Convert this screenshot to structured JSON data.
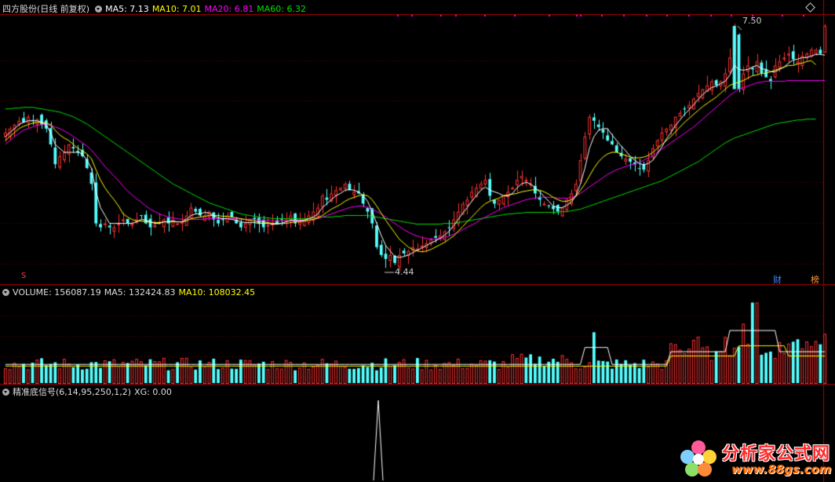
{
  "main_panel": {
    "stock_name": "四方股份",
    "period_label": "(日线 前复权)",
    "ma5": {
      "label": "MA5: 7.13",
      "color": "#ffffff"
    },
    "ma10": {
      "label": "MA10: 7.01",
      "color": "#ffff00"
    },
    "ma20": {
      "label": "MA20: 6.81",
      "color": "#ff00ff"
    },
    "ma60": {
      "label": "MA60: 6.32",
      "color": "#00e000"
    },
    "high_marker": "7.50",
    "low_marker": "4.44",
    "badge_fin": "财",
    "badge_rank": "榜",
    "badge_s": "S"
  },
  "volume_panel": {
    "volume_label": "VOLUME: 156087.19",
    "ma5_label": "MA5: 132424.83",
    "ma10_label": "MA10: 108032.45"
  },
  "indicator_panel": {
    "name_label": "精准底信号",
    "params": "(6,14,95,250,1,2)",
    "xg_label": "XG: 0.00"
  },
  "watermark": {
    "site": "分析家公式网",
    "url": "www.88gs.com"
  },
  "colors": {
    "up": "#ff3232",
    "down": "#54ffff",
    "ma5": "#ffffff",
    "ma10": "#ffff00",
    "ma20": "#ff00ff",
    "ma60": "#00e000",
    "grid": "#8b0000"
  },
  "chart_data": {
    "type": "candlestick",
    "price_range": [
      4.3,
      7.65
    ],
    "closes": [
      6.15,
      6.2,
      6.25,
      6.3,
      6.28,
      6.35,
      6.3,
      6.32,
      6.25,
      6.2,
      6.0,
      5.75,
      5.85,
      5.9,
      6.0,
      5.95,
      5.9,
      5.85,
      5.7,
      5.5,
      5.0,
      4.95,
      5.0,
      4.95,
      4.95,
      5.0,
      5.05,
      5.0,
      5.0,
      5.05,
      5.1,
      5.0,
      4.95,
      4.98,
      5.02,
      5.05,
      5.0,
      5.05,
      5.0,
      5.02,
      5.1,
      5.2,
      5.15,
      5.1,
      5.1,
      5.15,
      5.05,
      5.0,
      5.05,
      5.1,
      5.08,
      5.0,
      4.95,
      5.0,
      5.05,
      5.05,
      5.0,
      4.95,
      4.98,
      5.0,
      5.0,
      5.05,
      5.05,
      5.1,
      5.0,
      5.02,
      5.05,
      5.1,
      5.15,
      5.2,
      5.35,
      5.3,
      5.38,
      5.42,
      5.45,
      5.5,
      5.42,
      5.4,
      5.38,
      5.25,
      5.15,
      5.0,
      4.7,
      4.6,
      4.55,
      4.6,
      4.5,
      4.6,
      4.62,
      4.65,
      4.7,
      4.68,
      4.72,
      4.75,
      4.8,
      4.82,
      4.85,
      4.9,
      4.95,
      5.05,
      5.15,
      5.25,
      5.3,
      5.4,
      5.45,
      5.5,
      5.55,
      5.35,
      5.25,
      5.3,
      5.35,
      5.4,
      5.45,
      5.55,
      5.6,
      5.55,
      5.5,
      5.38,
      5.3,
      5.25,
      5.22,
      5.18,
      5.15,
      5.2,
      5.3,
      5.38,
      5.5,
      5.8,
      6.1,
      6.35,
      6.3,
      6.22,
      6.15,
      6.05,
      6.0,
      5.9,
      5.85,
      5.82,
      5.78,
      5.75,
      5.7,
      5.68,
      5.8,
      5.95,
      6.05,
      6.15,
      6.2,
      6.25,
      6.35,
      6.4,
      6.45,
      6.5,
      6.58,
      6.65,
      6.7,
      6.75,
      6.8,
      6.75,
      6.8,
      6.9,
      7.1,
      7.45,
      6.7,
      6.9,
      7.0,
      6.95,
      7.05,
      6.9,
      6.85,
      6.8,
      7.0,
      7.05,
      7.1,
      7.15,
      7.08,
      7.05,
      7.12,
      7.15,
      7.2,
      7.2,
      7.15,
      7.5
    ],
    "ma5": [
      6.1,
      6.15,
      6.2,
      6.25,
      6.28,
      6.3,
      6.3,
      6.3,
      6.28,
      6.25,
      6.15,
      6.0,
      5.95,
      5.9,
      5.9,
      5.9,
      5.9,
      5.88,
      5.8,
      5.7,
      5.4,
      5.2,
      5.1,
      5.0,
      5.0,
      5.0,
      5.0,
      5.0,
      5.0,
      5.02,
      5.05,
      5.04,
      5.02,
      5.0,
      5.0,
      5.02,
      5.02,
      5.03,
      5.02,
      5.02,
      5.05,
      5.1,
      5.12,
      5.12,
      5.14,
      5.13,
      5.1,
      5.07,
      5.06,
      5.06,
      5.05,
      5.04,
      5.02,
      5.01,
      5.01,
      5.01,
      5.0,
      5.0,
      5.0,
      4.99,
      4.99,
      5.0,
      5.02,
      5.04,
      5.04,
      5.04,
      5.04,
      5.06,
      5.08,
      5.12,
      5.2,
      5.25,
      5.3,
      5.35,
      5.38,
      5.42,
      5.43,
      5.42,
      5.4,
      5.35,
      5.28,
      5.15,
      5.0,
      4.85,
      4.72,
      4.65,
      4.58,
      4.57,
      4.58,
      4.6,
      4.63,
      4.66,
      4.69,
      4.72,
      4.75,
      4.78,
      4.81,
      4.85,
      4.9,
      4.97,
      5.05,
      5.13,
      5.2,
      5.28,
      5.35,
      5.42,
      5.46,
      5.42,
      5.4,
      5.38,
      5.35,
      5.35,
      5.38,
      5.45,
      5.5,
      5.52,
      5.5,
      5.45,
      5.4,
      5.34,
      5.28,
      5.22,
      5.2,
      5.2,
      5.23,
      5.27,
      5.35,
      5.5,
      5.7,
      5.95,
      6.1,
      6.18,
      6.2,
      6.2,
      6.12,
      6.05,
      5.98,
      5.92,
      5.85,
      5.8,
      5.76,
      5.74,
      5.76,
      5.8,
      5.88,
      5.97,
      6.07,
      6.15,
      6.24,
      6.31,
      6.38,
      6.44,
      6.5,
      6.57,
      6.63,
      6.68,
      6.72,
      6.74,
      6.77,
      6.8,
      6.88,
      7.0,
      6.95,
      6.94,
      6.95,
      6.98,
      7.0,
      6.96,
      6.95,
      6.92,
      6.92,
      6.95,
      6.98,
      7.03,
      7.07,
      7.08,
      7.1,
      7.1,
      7.12,
      7.14,
      7.14,
      7.13
    ],
    "ma10": [
      6.05,
      6.1,
      6.15,
      6.2,
      6.23,
      6.25,
      6.27,
      6.28,
      6.28,
      6.27,
      6.25,
      6.18,
      6.12,
      6.08,
      6.05,
      6.0,
      5.95,
      5.92,
      5.88,
      5.82,
      5.68,
      5.55,
      5.45,
      5.37,
      5.3,
      5.22,
      5.12,
      5.08,
      5.05,
      5.03,
      5.03,
      5.02,
      5.02,
      5.01,
      5.01,
      5.02,
      5.02,
      5.02,
      5.02,
      5.02,
      5.03,
      5.06,
      5.07,
      5.08,
      5.09,
      5.1,
      5.1,
      5.1,
      5.09,
      5.09,
      5.08,
      5.07,
      5.06,
      5.05,
      5.04,
      5.03,
      5.02,
      5.02,
      5.01,
      5.0,
      5.0,
      5.0,
      5.0,
      5.01,
      5.02,
      5.02,
      5.03,
      5.04,
      5.05,
      5.07,
      5.1,
      5.14,
      5.18,
      5.21,
      5.24,
      5.28,
      5.31,
      5.33,
      5.35,
      5.36,
      5.35,
      5.3,
      5.22,
      5.13,
      5.04,
      4.96,
      4.88,
      4.8,
      4.75,
      4.7,
      4.67,
      4.65,
      4.64,
      4.65,
      4.67,
      4.7,
      4.73,
      4.76,
      4.8,
      4.84,
      4.9,
      4.96,
      5.02,
      5.08,
      5.14,
      5.2,
      5.25,
      5.28,
      5.3,
      5.32,
      5.35,
      5.36,
      5.37,
      5.38,
      5.4,
      5.41,
      5.42,
      5.43,
      5.42,
      5.4,
      5.37,
      5.33,
      5.3,
      5.28,
      5.28,
      5.3,
      5.34,
      5.42,
      5.5,
      5.6,
      5.7,
      5.78,
      5.84,
      5.88,
      5.9,
      5.9,
      5.88,
      5.86,
      5.84,
      5.83,
      5.83,
      5.84,
      5.86,
      5.9,
      5.95,
      6.0,
      6.05,
      6.1,
      6.16,
      6.22,
      6.28,
      6.33,
      6.38,
      6.43,
      6.48,
      6.52,
      6.56,
      6.6,
      6.65,
      6.7,
      6.75,
      6.77,
      6.79,
      6.81,
      6.84,
      6.87,
      6.88,
      6.9,
      6.9,
      6.92,
      6.94,
      6.96,
      6.98,
      7.0,
      7.0,
      7.02,
      7.03,
      7.05,
      7.06,
      7.01
    ],
    "ma20": [
      6.0,
      6.05,
      6.1,
      6.14,
      6.18,
      6.2,
      6.22,
      6.24,
      6.25,
      6.25,
      6.24,
      6.22,
      6.2,
      6.17,
      6.14,
      6.1,
      6.06,
      6.02,
      5.98,
      5.93,
      5.86,
      5.79,
      5.72,
      5.66,
      5.6,
      5.54,
      5.47,
      5.41,
      5.36,
      5.31,
      5.27,
      5.22,
      5.18,
      5.15,
      5.12,
      5.1,
      5.08,
      5.07,
      5.06,
      5.05,
      5.05,
      5.05,
      5.05,
      5.05,
      5.06,
      5.06,
      5.06,
      5.06,
      5.06,
      5.06,
      5.06,
      5.06,
      5.05,
      5.05,
      5.05,
      5.05,
      5.04,
      5.04,
      5.04,
      5.03,
      5.03,
      5.03,
      5.03,
      5.03,
      5.03,
      5.03,
      5.03,
      5.04,
      5.05,
      5.06,
      5.08,
      5.1,
      5.12,
      5.14,
      5.16,
      5.18,
      5.2,
      5.21,
      5.22,
      5.22,
      5.2,
      5.18,
      5.15,
      5.12,
      5.08,
      5.04,
      5.0,
      4.96,
      4.92,
      4.89,
      4.86,
      4.84,
      4.82,
      4.81,
      4.8,
      4.8,
      4.81,
      4.82,
      4.84,
      4.86,
      4.89,
      4.92,
      4.95,
      4.98,
      5.01,
      5.05,
      5.08,
      5.11,
      5.14,
      5.17,
      5.2,
      5.22,
      5.24,
      5.26,
      5.28,
      5.3,
      5.31,
      5.32,
      5.33,
      5.33,
      5.33,
      5.33,
      5.32,
      5.32,
      5.32,
      5.33,
      5.35,
      5.38,
      5.42,
      5.46,
      5.5,
      5.54,
      5.58,
      5.62,
      5.65,
      5.68,
      5.7,
      5.72,
      5.74,
      5.75,
      5.77,
      5.8,
      5.83,
      5.86,
      5.9,
      5.94,
      5.98,
      6.02,
      6.06,
      6.1,
      6.14,
      6.18,
      6.22,
      6.27,
      6.32,
      6.37,
      6.42,
      6.47,
      6.52,
      6.57,
      6.62,
      6.66,
      6.7,
      6.72,
      6.74,
      6.76,
      6.78,
      6.79,
      6.8,
      6.8,
      6.8,
      6.8,
      6.8,
      6.81,
      6.81,
      6.81,
      6.81,
      6.81,
      6.81,
      6.81,
      6.81,
      6.81
    ],
    "ma60": [
      6.45,
      6.45,
      6.46,
      6.46,
      6.47,
      6.47,
      6.47,
      6.46,
      6.45,
      6.44,
      6.43,
      6.42,
      6.41,
      6.39,
      6.37,
      6.35,
      6.32,
      6.29,
      6.26,
      6.22,
      6.18,
      6.14,
      6.1,
      6.06,
      6.02,
      5.98,
      5.94,
      5.9,
      5.86,
      5.82,
      5.78,
      5.74,
      5.7,
      5.66,
      5.62,
      5.58,
      5.54,
      5.5,
      5.47,
      5.44,
      5.41,
      5.38,
      5.35,
      5.32,
      5.29,
      5.26,
      5.24,
      5.22,
      5.2,
      5.18,
      5.16,
      5.14,
      5.12,
      5.11,
      5.1,
      5.09,
      5.08,
      5.07,
      5.07,
      5.06,
      5.06,
      5.06,
      5.06,
      5.06,
      5.06,
      5.06,
      5.06,
      5.06,
      5.07,
      5.07,
      5.08,
      5.08,
      5.08,
      5.09,
      5.09,
      5.1,
      5.1,
      5.1,
      5.1,
      5.1,
      5.1,
      5.09,
      5.08,
      5.07,
      5.06,
      5.05,
      5.04,
      5.03,
      5.02,
      5.01,
      5.0,
      4.99,
      4.99,
      4.99,
      4.99,
      4.99,
      4.99,
      5.0,
      5.0,
      5.0,
      5.01,
      5.02,
      5.03,
      5.04,
      5.05,
      5.06,
      5.07,
      5.08,
      5.09,
      5.1,
      5.11,
      5.12,
      5.12,
      5.13,
      5.13,
      5.14,
      5.14,
      5.14,
      5.14,
      5.14,
      5.14,
      5.14,
      5.14,
      5.15,
      5.15,
      5.16,
      5.17,
      5.18,
      5.2,
      5.22,
      5.24,
      5.26,
      5.28,
      5.3,
      5.32,
      5.34,
      5.36,
      5.38,
      5.4,
      5.42,
      5.44,
      5.46,
      5.48,
      5.5,
      5.52,
      5.54,
      5.57,
      5.6,
      5.63,
      5.66,
      5.69,
      5.72,
      5.75,
      5.78,
      5.82,
      5.86,
      5.9,
      5.94,
      5.98,
      6.02,
      6.05,
      6.08,
      6.1,
      6.12,
      6.14,
      6.16,
      6.18,
      6.2,
      6.22,
      6.24,
      6.26,
      6.27,
      6.28,
      6.29,
      6.3,
      6.31,
      6.31,
      6.32,
      6.32,
      6.32
    ]
  }
}
